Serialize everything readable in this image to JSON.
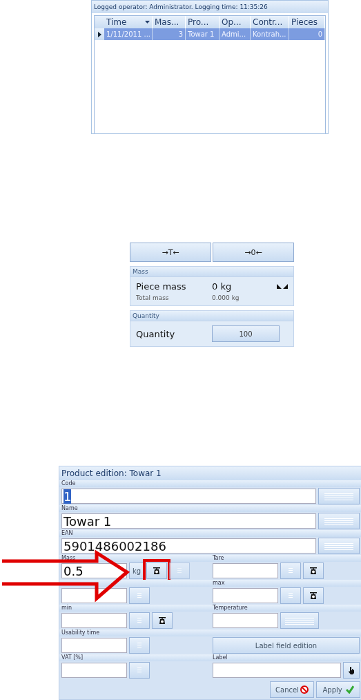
{
  "log_panel": {
    "status": "Logged operator: Administrator. Logging time: 11:35:26",
    "columns": [
      {
        "label": "Time",
        "sorted": true
      },
      {
        "label": "Mas...",
        "sorted": false
      },
      {
        "label": "Pro...",
        "sorted": false
      },
      {
        "label": "Op...",
        "sorted": false
      },
      {
        "label": "Contr...",
        "sorted": false
      },
      {
        "label": "Pieces",
        "sorted": false
      }
    ],
    "rows": [
      {
        "selected": true,
        "cells": [
          "1/11/2011 ...",
          "3",
          "Towar 1",
          "Admi...",
          "Kontrah...",
          "0"
        ]
      }
    ]
  },
  "scale_panel": {
    "buttons": [
      "→T←",
      "→0←"
    ],
    "mass": {
      "header": "Mass",
      "main_label": "Piece mass",
      "main_value": "0 kg",
      "sub_label": "Total mass",
      "sub_value": "0.000 kg"
    },
    "quantity": {
      "header": "Quantity",
      "label": "Quantity",
      "value": "100"
    }
  },
  "product_form": {
    "title": "Product edition: Towar 1",
    "full_rows": [
      {
        "label": "Code",
        "value": "1",
        "selected": true
      },
      {
        "label": "Name",
        "value": "Towar 1",
        "selected": false
      },
      {
        "label": "EAN",
        "value": "5901486002186",
        "selected": false
      }
    ],
    "half_rows": [
      [
        {
          "label": "Mass",
          "value": "0.5",
          "controls": [
            {
              "kind": "unit",
              "text": "kg"
            },
            {
              "kind": "scale",
              "highlighted": true
            },
            {
              "kind": "keypad",
              "disabled": true
            }
          ]
        },
        {
          "label": "Tare",
          "controls": [
            {
              "kind": "keypad"
            },
            {
              "kind": "scale"
            }
          ]
        }
      ],
      [
        {
          "controls": [
            {
              "kind": "keypad"
            }
          ]
        },
        {
          "label": "max",
          "controls": [
            {
              "kind": "keypad"
            },
            {
              "kind": "scale"
            }
          ]
        }
      ],
      [
        {
          "label": "min",
          "controls": [
            {
              "kind": "keypad"
            },
            {
              "kind": "scale"
            }
          ]
        },
        {
          "label": "Temperature",
          "controls": [
            {
              "kind": "keyboard"
            }
          ]
        }
      ],
      [
        {
          "label": "Usability time",
          "controls": [
            {
              "kind": "keypad"
            }
          ]
        },
        {
          "kind": "wide_button",
          "text": "Label field edition"
        }
      ],
      [
        {
          "label": "VAT [%]",
          "controls": [
            {
              "kind": "keypad"
            }
          ]
        },
        {
          "kind": "wide_field",
          "label": "Label"
        }
      ]
    ],
    "actions": [
      {
        "kind": "cancel",
        "text": "Cancel"
      },
      {
        "kind": "apply",
        "text": "Apply"
      }
    ]
  }
}
